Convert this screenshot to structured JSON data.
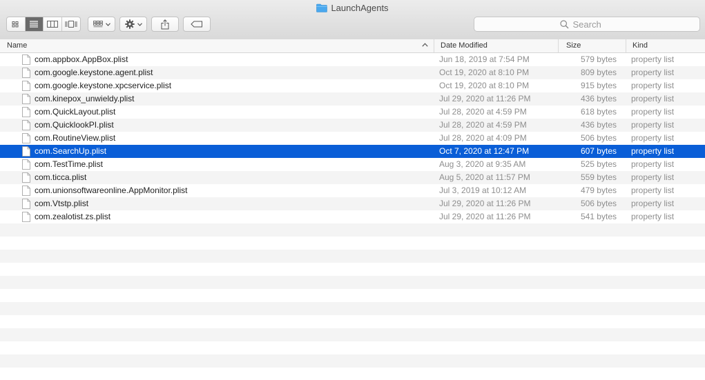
{
  "window": {
    "title": "LaunchAgents"
  },
  "toolbar": {
    "view_modes": [
      "icon-view",
      "list-view",
      "column-view",
      "cover-flow-view"
    ],
    "active_view": "list-view",
    "buttons": [
      "group-by",
      "action-gear",
      "share",
      "edit-tags"
    ]
  },
  "search": {
    "placeholder": "Search",
    "value": ""
  },
  "columns": {
    "name": "Name",
    "date": "Date Modified",
    "size": "Size",
    "kind": "Kind"
  },
  "files": [
    {
      "name": "com.appbox.AppBox.plist",
      "date": "Jun 18, 2019 at 7:54 PM",
      "size": "579 bytes",
      "kind": "property list"
    },
    {
      "name": "com.google.keystone.agent.plist",
      "date": "Oct 19, 2020 at 8:10 PM",
      "size": "809 bytes",
      "kind": "property list"
    },
    {
      "name": "com.google.keystone.xpcservice.plist",
      "date": "Oct 19, 2020 at 8:10 PM",
      "size": "915 bytes",
      "kind": "property list"
    },
    {
      "name": "com.kinepox_unwieldy.plist",
      "date": "Jul 29, 2020 at 11:26 PM",
      "size": "436 bytes",
      "kind": "property list"
    },
    {
      "name": "com.QuickLayout.plist",
      "date": "Jul 28, 2020 at 4:59 PM",
      "size": "618 bytes",
      "kind": "property list"
    },
    {
      "name": "com.QuicklookPI.plist",
      "date": "Jul 28, 2020 at 4:59 PM",
      "size": "436 bytes",
      "kind": "property list"
    },
    {
      "name": "com.RoutineView.plist",
      "date": "Jul 28, 2020 at 4:09 PM",
      "size": "506 bytes",
      "kind": "property list"
    },
    {
      "name": "com.SearchUp.plist",
      "date": "Oct 7, 2020 at 12:47 PM",
      "size": "607 bytes",
      "kind": "property list",
      "selected": true
    },
    {
      "name": "com.TestTime.plist",
      "date": "Aug 3, 2020 at 9:35 AM",
      "size": "525 bytes",
      "kind": "property list"
    },
    {
      "name": "com.ticca.plist",
      "date": "Aug 5, 2020 at 11:57 PM",
      "size": "559 bytes",
      "kind": "property list"
    },
    {
      "name": "com.unionsoftwareonline.AppMonitor.plist",
      "date": "Jul 3, 2019 at 10:12 AM",
      "size": "479 bytes",
      "kind": "property list"
    },
    {
      "name": "com.Vtstp.plist",
      "date": "Jul 29, 2020 at 11:26 PM",
      "size": "506 bytes",
      "kind": "property list"
    },
    {
      "name": "com.zealotist.zs.plist",
      "date": "Jul 29, 2020 at 11:26 PM",
      "size": "541 bytes",
      "kind": "property list"
    }
  ],
  "colors": {
    "selection": "#0a5ed7",
    "folder": "#4aa8ee",
    "stripe": "#f4f4f4"
  }
}
